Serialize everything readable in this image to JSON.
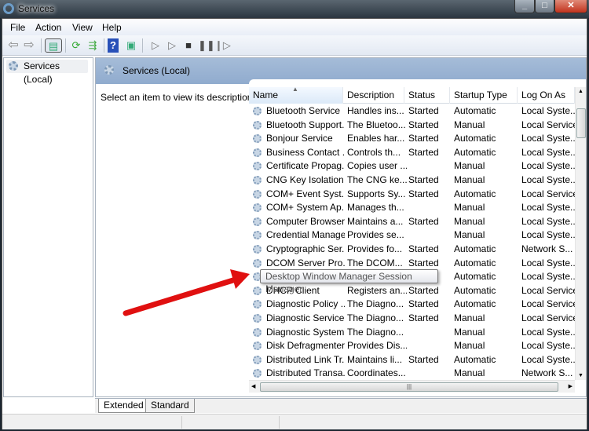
{
  "window": {
    "title": "Services",
    "controls": [
      "minimize",
      "maximize",
      "close"
    ]
  },
  "menu": [
    "File",
    "Action",
    "View",
    "Help"
  ],
  "toolbar": [
    "back-icon",
    "forward-icon",
    "show-hide-console-tree-icon",
    "refresh-icon",
    "export-list-icon",
    "help-icon",
    "properties-icon",
    "start-service-icon",
    "start-service-alt-icon",
    "stop-service-icon",
    "pause-service-icon",
    "resume-service-icon"
  ],
  "tree": {
    "item": "Services (Local)"
  },
  "panel": {
    "title": "Services (Local)",
    "description": "Select an item to view its description."
  },
  "table": {
    "columns": [
      "Name",
      "Description",
      "Status",
      "Startup Type",
      "Log On As"
    ],
    "sort_column": "Name",
    "rows": [
      [
        "Bluetooth Service",
        "Handles ins...",
        "Started",
        "Automatic",
        "Local Syste..."
      ],
      [
        "Bluetooth Support...",
        "The Bluetoo...",
        "Started",
        "Manual",
        "Local Service"
      ],
      [
        "Bonjour Service",
        "Enables har...",
        "Started",
        "Automatic",
        "Local Syste..."
      ],
      [
        "Business Contact ...",
        "Controls th...",
        "Started",
        "Automatic",
        "Local Syste..."
      ],
      [
        "Certificate Propag...",
        "Copies user ...",
        "",
        "Manual",
        "Local Syste..."
      ],
      [
        "CNG Key Isolation",
        "The CNG ke...",
        "Started",
        "Manual",
        "Local Syste..."
      ],
      [
        "COM+ Event Syst...",
        "Supports Sy...",
        "Started",
        "Automatic",
        "Local Service"
      ],
      [
        "COM+ System Ap...",
        "Manages th...",
        "",
        "Manual",
        "Local Syste..."
      ],
      [
        "Computer Browser",
        "Maintains a...",
        "Started",
        "Manual",
        "Local Syste..."
      ],
      [
        "Credential Manager",
        "Provides se...",
        "",
        "Manual",
        "Local Syste..."
      ],
      [
        "Cryptographic Ser...",
        "Provides fo...",
        "Started",
        "Automatic",
        "Network S..."
      ],
      [
        "DCOM Server Pro...",
        "The DCOM...",
        "Started",
        "Automatic",
        "Local Syste..."
      ],
      [
        "",
        "",
        "",
        "Automatic",
        "Local Syste..."
      ],
      [
        "DHCP Client",
        "Registers an...",
        "Started",
        "Automatic",
        "Local Service"
      ],
      [
        "Diagnostic Policy ...",
        "The Diagno...",
        "Started",
        "Automatic",
        "Local Service"
      ],
      [
        "Diagnostic Service...",
        "The Diagno...",
        "Started",
        "Manual",
        "Local Service"
      ],
      [
        "Diagnostic System...",
        "The Diagno...",
        "",
        "Manual",
        "Local Syste..."
      ],
      [
        "Disk Defragmenter",
        "Provides Dis...",
        "",
        "Manual",
        "Local Syste..."
      ],
      [
        "Distributed Link Tr...",
        "Maintains li...",
        "Started",
        "Automatic",
        "Local Syste..."
      ],
      [
        "Distributed Transa...",
        "Coordinates...",
        "",
        "Manual",
        "Network S..."
      ]
    ]
  },
  "tooltip": "Desktop Window Manager Session Manager",
  "tabs": [
    "Extended",
    "Standard"
  ],
  "annotation": {
    "color": "#e01010"
  }
}
